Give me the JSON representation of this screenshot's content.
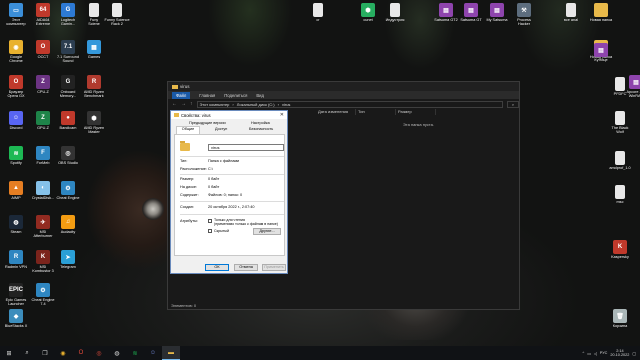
{
  "desktop_icons": [
    {
      "label": "Этот\nкомпьютер",
      "icon": "computer-icon",
      "color": "#3b8ed8",
      "glyph": "▭"
    },
    {
      "label": "AIDA64\nExtreme",
      "icon": "aida64-icon",
      "color": "#c0392b",
      "glyph": "64"
    },
    {
      "label": "Logitech\nGamin...",
      "icon": "logitech-icon",
      "color": "#2d7bd4",
      "glyph": "G"
    },
    {
      "label": "Funy\nSciene",
      "icon": "file-icon",
      "color": "#e8e8e8",
      "glyph": ""
    },
    {
      "label": "Funny Science\nRack 2",
      "icon": "file-icon",
      "color": "#e8e8e8",
      "glyph": ""
    },
    {
      "label": "Google\nChrome",
      "icon": "chrome-icon",
      "color": "#e9b12e",
      "glyph": "◉"
    },
    {
      "label": "OCCT",
      "icon": "occt-icon",
      "color": "#c0392b",
      "glyph": "O"
    },
    {
      "label": "7.1 Surround\nSound",
      "icon": "sound-icon",
      "color": "#2c3e50",
      "glyph": "7.1"
    },
    {
      "label": "Games",
      "icon": "games-icon",
      "color": "#3498db",
      "glyph": "▦"
    },
    {
      "label": "Браузер\nOpera GX",
      "icon": "opera-icon",
      "color": "#c0392b",
      "glyph": "O"
    },
    {
      "label": "CPU-Z",
      "icon": "cpuz-icon",
      "color": "#6c3483",
      "glyph": "Z"
    },
    {
      "label": "Onboard\nMemory...",
      "icon": "memory-icon",
      "color": "#222",
      "glyph": "G"
    },
    {
      "label": "AMD Ryzen\nBenchmark",
      "icon": "amd-icon",
      "color": "#b03a2e",
      "glyph": "R"
    },
    {
      "label": "Discord",
      "icon": "discord-icon",
      "color": "#5865f2",
      "glyph": "☺"
    },
    {
      "label": "GPU-Z",
      "icon": "gpuz-icon",
      "color": "#1e8449",
      "glyph": "Z"
    },
    {
      "label": "Bandicam",
      "icon": "bandicam-icon",
      "color": "#c0392b",
      "glyph": "●"
    },
    {
      "label": "AMD Ryzen\nMaster",
      "icon": "ryzen-icon",
      "color": "#333",
      "glyph": "⬢"
    },
    {
      "label": "Spotify",
      "icon": "spotify-icon",
      "color": "#1db954",
      "glyph": "≋"
    },
    {
      "label": "ForMeb",
      "icon": "formeb-icon",
      "color": "#2e86c1",
      "glyph": "F"
    },
    {
      "label": "OBS Studio",
      "icon": "obs-icon",
      "color": "#333",
      "glyph": "◎"
    },
    {
      "label": "AIMP",
      "icon": "aimp-icon",
      "color": "#e67e22",
      "glyph": "▲"
    },
    {
      "label": "CrystalDisk...",
      "icon": "crystaldisk-icon",
      "color": "#85c1e9",
      "glyph": "◐"
    },
    {
      "label": "Cheat Engine",
      "icon": "cheatengine-icon",
      "color": "#2e86c1",
      "glyph": "⚙"
    },
    {
      "label": "Steam",
      "icon": "steam-icon",
      "color": "#1b2838",
      "glyph": "◍"
    },
    {
      "label": "MSI\nAfterburner",
      "icon": "afterburner-icon",
      "color": "#922b21",
      "glyph": "✈"
    },
    {
      "label": "Audacity",
      "icon": "audacity-icon",
      "color": "#f39c12",
      "glyph": "♫"
    },
    {
      "label": "Radmin VPN",
      "icon": "radmin-icon",
      "color": "#2e86c1",
      "glyph": "R"
    },
    {
      "label": "MSI\nKombustor 3",
      "icon": "kombustor-icon",
      "color": "#7b241c",
      "glyph": "K"
    },
    {
      "label": "Telegram",
      "icon": "telegram-icon",
      "color": "#2a9fd6",
      "glyph": "➤"
    },
    {
      "label": "Epic Games\nLauncher",
      "icon": "epic-icon",
      "color": "#222",
      "glyph": "EPIC"
    },
    {
      "label": "Cheat Engine\n7.4",
      "icon": "cheatengine-icon",
      "color": "#2e86c1",
      "glyph": "⚙"
    },
    {
      "label": "BlueStacks X",
      "icon": "bluestacks-icon",
      "color": "#3c8dbc",
      "glyph": "◆"
    },
    {
      "label": "cr",
      "icon": "file-icon",
      "color": "#e8e8e8",
      "glyph": ""
    },
    {
      "label": "cunet",
      "icon": "cunet-icon",
      "color": "#27ae60",
      "glyph": "⬢"
    },
    {
      "label": "Индустрия",
      "icon": "file-icon",
      "color": "#e8e8e8",
      "glyph": ""
    },
    {
      "label": "Satsuma GT2",
      "icon": "winrar-icon",
      "color": "#8e44ad",
      "glyph": "▤"
    },
    {
      "label": "Satsuma GT",
      "icon": "winrar-icon",
      "color": "#8e44ad",
      "glyph": "▤"
    },
    {
      "label": "My Satsuma",
      "icon": "winrar-icon",
      "color": "#8e44ad",
      "glyph": "▤"
    },
    {
      "label": "Process\nHacker",
      "icon": "processhacker-icon",
      "color": "#5d6d7e",
      "glyph": "⚒"
    },
    {
      "label": "все anal",
      "icon": "file-icon",
      "color": "#e8e8e8",
      "glyph": ""
    },
    {
      "label": "Новая папка",
      "icon": "folder-icon",
      "color": "#e8b94a",
      "glyph": ""
    },
    {
      "label": "Новая папка",
      "icon": "folder-icon",
      "color": "#e8b94a",
      "glyph": ""
    },
    {
      "label": "КуЯйце",
      "icon": "winrar-icon",
      "color": "#8e44ad",
      "glyph": "▤"
    },
    {
      "label": "Apcore ZIP\nWinRAR",
      "icon": "winrar-icon",
      "color": "#8e44ad",
      "glyph": "▤"
    },
    {
      "label": "PFDFC",
      "icon": "file-icon",
      "color": "#e8e8e8",
      "glyph": ""
    },
    {
      "label": "The Black\nWolf",
      "icon": "file-icon",
      "color": "#e8e8e8",
      "glyph": ""
    },
    {
      "label": "amdprof_1.0",
      "icon": "file-icon",
      "color": "#e8e8e8",
      "glyph": ""
    },
    {
      "label": "msc",
      "icon": "file-icon",
      "color": "#e8e8e8",
      "glyph": ""
    },
    {
      "label": "Kaspersky",
      "icon": "kaspersky-icon",
      "color": "#c0392b",
      "glyph": "K"
    },
    {
      "label": "Корзина",
      "icon": "recycle-bin-icon",
      "color": "#aab7b8",
      "glyph": "🗑"
    }
  ],
  "explorer": {
    "title": "virus",
    "ribbon": [
      "Файл",
      "Главная",
      "Поделиться",
      "Вид"
    ],
    "path": [
      "Этот компьютер",
      "Локальный диск (C:)",
      "virus"
    ],
    "columns": [
      "Дата изменения",
      "Тип",
      "Размер"
    ],
    "empty_text": "Эта папка пуста.",
    "status": "Элементов: 0"
  },
  "props": {
    "title": "Свойства: virus",
    "tabs": {
      "prev_versions": "Предыдущие версии",
      "settings": "Настройка",
      "general": "Общие",
      "access": "Доступ",
      "security": "Безопасность"
    },
    "name": "virus",
    "rows": {
      "type_k": "Тип:",
      "type_v": "Папка с файлами",
      "loc_k": "Расположение:",
      "loc_v": "C:\\",
      "size_k": "Размер:",
      "size_v": "0 байт",
      "disk_k": "На диске:",
      "disk_v": "0 байт",
      "contains_k": "Содержит:",
      "contains_v": "Файлов: 0; папок: 0",
      "created_k": "Создан:",
      "created_v": "20 октября 2022 г., 2:07:40",
      "attrs_k": "Атрибуты:"
    },
    "attr_readonly": "Только для чтения\n(применимо только к файлам в папке)",
    "attr_hidden": "Скрытый",
    "other_button": "Другие...",
    "ok": "ОК",
    "cancel": "Отмена",
    "apply": "Применить"
  },
  "taskbar": {
    "lang": "РУС",
    "time": "2:14",
    "date": "20.10.2022",
    "apps": [
      "start-icon",
      "search-icon",
      "chrome-icon",
      "opera-icon",
      "steam-icon",
      "spotify-icon",
      "discord-icon",
      "explorer-icon"
    ]
  }
}
